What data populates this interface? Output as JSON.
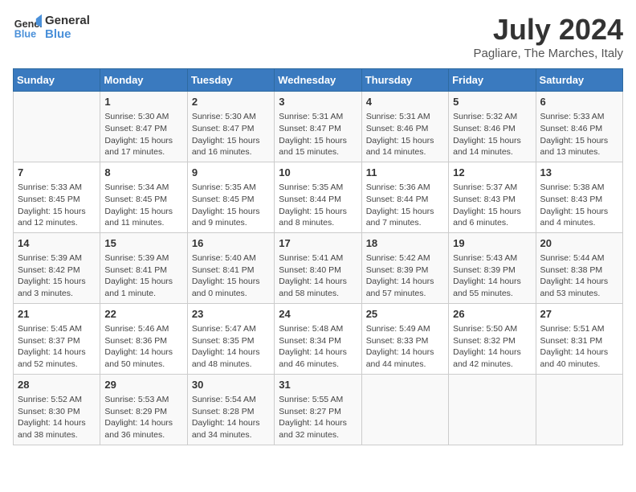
{
  "header": {
    "logo_line1": "General",
    "logo_line2": "Blue",
    "month": "July 2024",
    "location": "Pagliare, The Marches, Italy"
  },
  "weekdays": [
    "Sunday",
    "Monday",
    "Tuesday",
    "Wednesday",
    "Thursday",
    "Friday",
    "Saturday"
  ],
  "weeks": [
    [
      {
        "day": "",
        "info": ""
      },
      {
        "day": "1",
        "info": "Sunrise: 5:30 AM\nSunset: 8:47 PM\nDaylight: 15 hours\nand 17 minutes."
      },
      {
        "day": "2",
        "info": "Sunrise: 5:30 AM\nSunset: 8:47 PM\nDaylight: 15 hours\nand 16 minutes."
      },
      {
        "day": "3",
        "info": "Sunrise: 5:31 AM\nSunset: 8:47 PM\nDaylight: 15 hours\nand 15 minutes."
      },
      {
        "day": "4",
        "info": "Sunrise: 5:31 AM\nSunset: 8:46 PM\nDaylight: 15 hours\nand 14 minutes."
      },
      {
        "day": "5",
        "info": "Sunrise: 5:32 AM\nSunset: 8:46 PM\nDaylight: 15 hours\nand 14 minutes."
      },
      {
        "day": "6",
        "info": "Sunrise: 5:33 AM\nSunset: 8:46 PM\nDaylight: 15 hours\nand 13 minutes."
      }
    ],
    [
      {
        "day": "7",
        "info": "Sunrise: 5:33 AM\nSunset: 8:45 PM\nDaylight: 15 hours\nand 12 minutes."
      },
      {
        "day": "8",
        "info": "Sunrise: 5:34 AM\nSunset: 8:45 PM\nDaylight: 15 hours\nand 11 minutes."
      },
      {
        "day": "9",
        "info": "Sunrise: 5:35 AM\nSunset: 8:45 PM\nDaylight: 15 hours\nand 9 minutes."
      },
      {
        "day": "10",
        "info": "Sunrise: 5:35 AM\nSunset: 8:44 PM\nDaylight: 15 hours\nand 8 minutes."
      },
      {
        "day": "11",
        "info": "Sunrise: 5:36 AM\nSunset: 8:44 PM\nDaylight: 15 hours\nand 7 minutes."
      },
      {
        "day": "12",
        "info": "Sunrise: 5:37 AM\nSunset: 8:43 PM\nDaylight: 15 hours\nand 6 minutes."
      },
      {
        "day": "13",
        "info": "Sunrise: 5:38 AM\nSunset: 8:43 PM\nDaylight: 15 hours\nand 4 minutes."
      }
    ],
    [
      {
        "day": "14",
        "info": "Sunrise: 5:39 AM\nSunset: 8:42 PM\nDaylight: 15 hours\nand 3 minutes."
      },
      {
        "day": "15",
        "info": "Sunrise: 5:39 AM\nSunset: 8:41 PM\nDaylight: 15 hours\nand 1 minute."
      },
      {
        "day": "16",
        "info": "Sunrise: 5:40 AM\nSunset: 8:41 PM\nDaylight: 15 hours\nand 0 minutes."
      },
      {
        "day": "17",
        "info": "Sunrise: 5:41 AM\nSunset: 8:40 PM\nDaylight: 14 hours\nand 58 minutes."
      },
      {
        "day": "18",
        "info": "Sunrise: 5:42 AM\nSunset: 8:39 PM\nDaylight: 14 hours\nand 57 minutes."
      },
      {
        "day": "19",
        "info": "Sunrise: 5:43 AM\nSunset: 8:39 PM\nDaylight: 14 hours\nand 55 minutes."
      },
      {
        "day": "20",
        "info": "Sunrise: 5:44 AM\nSunset: 8:38 PM\nDaylight: 14 hours\nand 53 minutes."
      }
    ],
    [
      {
        "day": "21",
        "info": "Sunrise: 5:45 AM\nSunset: 8:37 PM\nDaylight: 14 hours\nand 52 minutes."
      },
      {
        "day": "22",
        "info": "Sunrise: 5:46 AM\nSunset: 8:36 PM\nDaylight: 14 hours\nand 50 minutes."
      },
      {
        "day": "23",
        "info": "Sunrise: 5:47 AM\nSunset: 8:35 PM\nDaylight: 14 hours\nand 48 minutes."
      },
      {
        "day": "24",
        "info": "Sunrise: 5:48 AM\nSunset: 8:34 PM\nDaylight: 14 hours\nand 46 minutes."
      },
      {
        "day": "25",
        "info": "Sunrise: 5:49 AM\nSunset: 8:33 PM\nDaylight: 14 hours\nand 44 minutes."
      },
      {
        "day": "26",
        "info": "Sunrise: 5:50 AM\nSunset: 8:32 PM\nDaylight: 14 hours\nand 42 minutes."
      },
      {
        "day": "27",
        "info": "Sunrise: 5:51 AM\nSunset: 8:31 PM\nDaylight: 14 hours\nand 40 minutes."
      }
    ],
    [
      {
        "day": "28",
        "info": "Sunrise: 5:52 AM\nSunset: 8:30 PM\nDaylight: 14 hours\nand 38 minutes."
      },
      {
        "day": "29",
        "info": "Sunrise: 5:53 AM\nSunset: 8:29 PM\nDaylight: 14 hours\nand 36 minutes."
      },
      {
        "day": "30",
        "info": "Sunrise: 5:54 AM\nSunset: 8:28 PM\nDaylight: 14 hours\nand 34 minutes."
      },
      {
        "day": "31",
        "info": "Sunrise: 5:55 AM\nSunset: 8:27 PM\nDaylight: 14 hours\nand 32 minutes."
      },
      {
        "day": "",
        "info": ""
      },
      {
        "day": "",
        "info": ""
      },
      {
        "day": "",
        "info": ""
      }
    ]
  ]
}
